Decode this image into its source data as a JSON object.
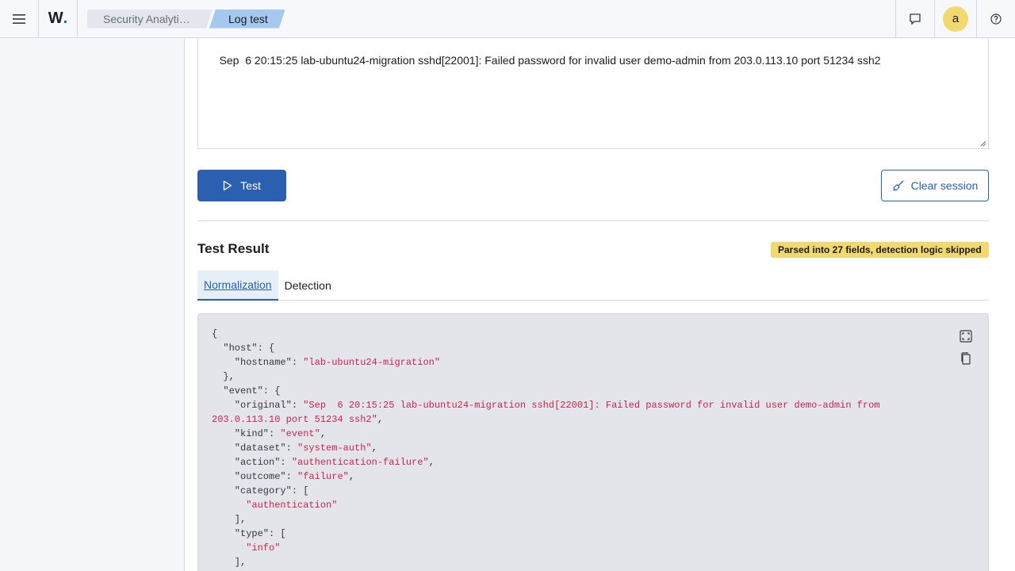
{
  "header": {
    "breadcrumbs": [
      "Security Analyti…",
      "Log test"
    ]
  },
  "input": {
    "log_line": "Sep  6 20:15:25 lab-ubuntu24-migration sshd[22001]: Failed password for invalid user demo-admin from 203.0.113.10 port 51234 ssh2"
  },
  "avatar_letter": "a",
  "actions": {
    "test_label": "Test",
    "clear_label": "Clear session"
  },
  "result": {
    "title": "Test Result",
    "badge": "Parsed into 27 fields, detection logic skipped",
    "tabs": [
      "Normalization",
      "Detection"
    ]
  },
  "colors": {
    "primary": "#2b5fb0",
    "badge": "#f1d86f",
    "string": "#c7254e"
  },
  "code": {
    "l01": "{",
    "l02_key": "  \"host\": {",
    "l03_key": "    \"hostname\": ",
    "l03_val": "\"lab-ubuntu24-migration\"",
    "l04": "  },",
    "l05_key": "  \"event\": {",
    "l06_key": "    \"original\": ",
    "l06_val": "\"Sep  6 20:15:25 lab-ubuntu24-migration sshd[22001]: Failed password for invalid user demo-admin from",
    "l07_val": "203.0.113.10 port 51234 ssh2\"",
    "l07_end": ",",
    "l08_key": "    \"kind\": ",
    "l08_val": "\"event\"",
    "l09_key": "    \"dataset\": ",
    "l09_val": "\"system-auth\"",
    "l10_key": "    \"action\": ",
    "l10_val": "\"authentication-failure\"",
    "l11_key": "    \"outcome\": ",
    "l11_val": "\"failure\"",
    "l12_key": "    \"category\": [",
    "l13_val": "      \"authentication\"",
    "l14": "    ],",
    "l15_key": "    \"type\": [",
    "l16_val": "      \"info\"",
    "l17": "    ],"
  }
}
